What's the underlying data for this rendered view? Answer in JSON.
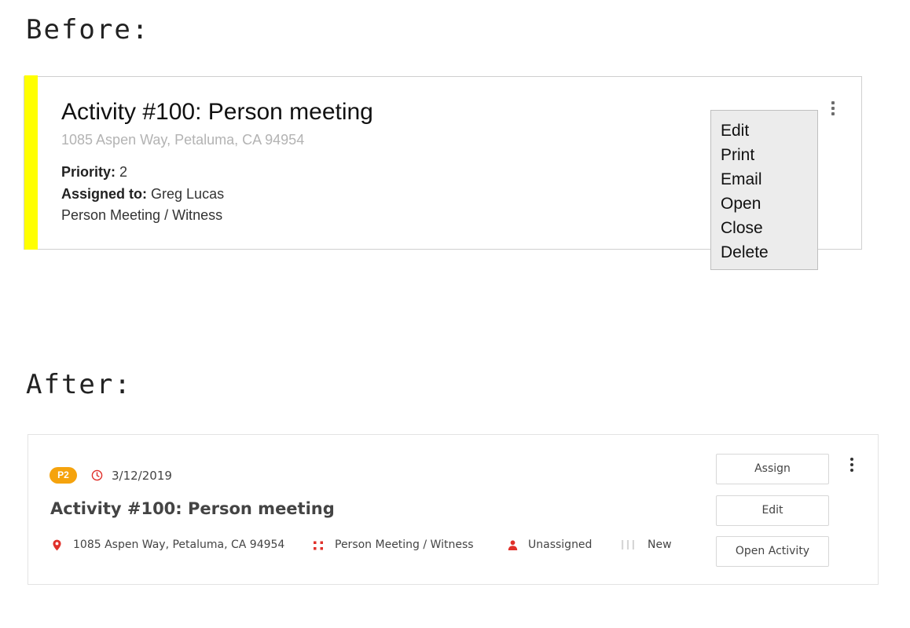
{
  "headings": {
    "before": "Before:",
    "after": "After:"
  },
  "before": {
    "stripe_color": "#ffff00",
    "title": "Activity #100: Person meeting",
    "address": "1085 Aspen Way, Petaluma, CA 94954",
    "priority_label": "Priority:",
    "priority_value": "2",
    "assigned_label": "Assigned to:",
    "assigned_value": "Greg Lucas",
    "type": "Person Meeting / Witness",
    "menu_icon": "kebab-menu-icon",
    "menu": {
      "items": [
        {
          "label": "Edit"
        },
        {
          "label": "Print"
        },
        {
          "label": "Email"
        },
        {
          "label": "Open"
        },
        {
          "label": "Close"
        },
        {
          "label": "Delete"
        }
      ]
    }
  },
  "after": {
    "priority_badge": "P2",
    "priority_color": "#f5a30d",
    "accent_color": "#e0302a",
    "date_icon": "clock-icon",
    "date": "3/12/2019",
    "title": "Activity #100: Person meeting",
    "address_icon": "map-pin-icon",
    "address": "1085 Aspen Way, Petaluma, CA 94954",
    "type_icon": "grid-dots-icon",
    "type": "Person Meeting / Witness",
    "assignee_icon": "person-icon",
    "assignee": "Unassigned",
    "status_icon": "status-bars-icon",
    "status": "New",
    "buttons": {
      "assign": "Assign",
      "edit": "Edit",
      "open": "Open Activity"
    },
    "menu_icon": "kebab-menu-icon"
  }
}
